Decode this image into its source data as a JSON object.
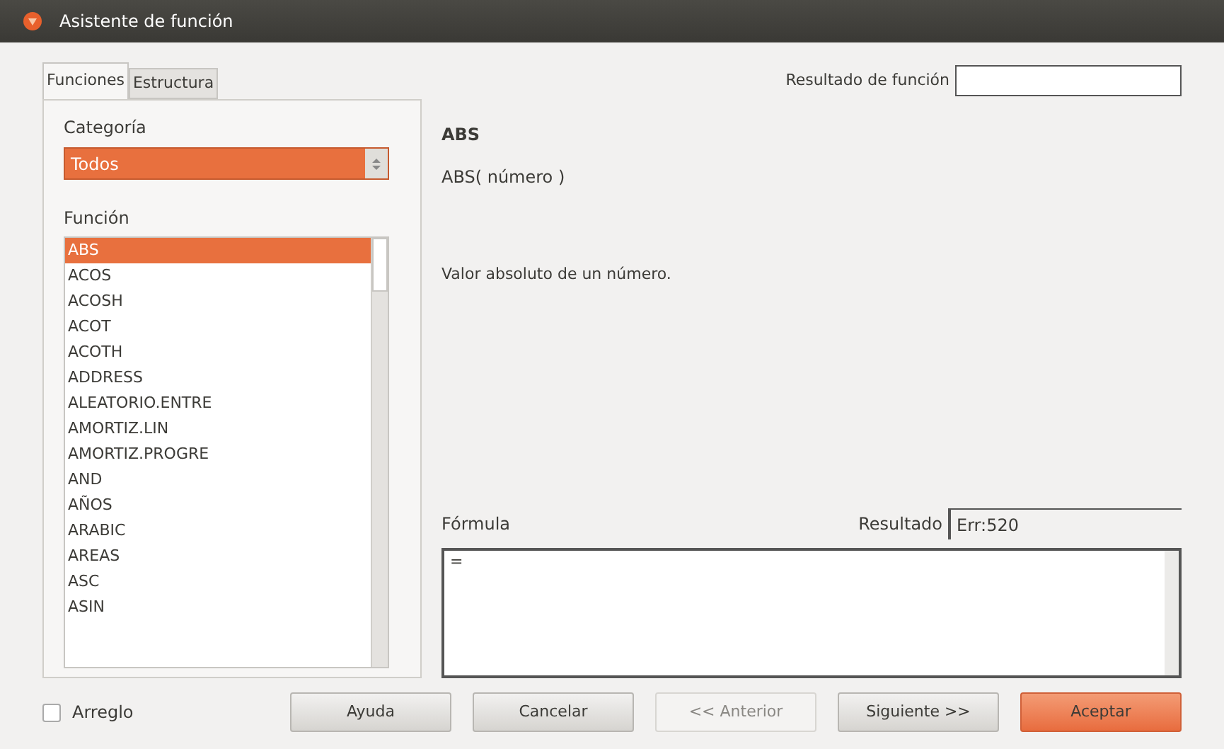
{
  "window": {
    "title": "Asistente de función"
  },
  "tabs": [
    {
      "label": "Funciones",
      "selected": true
    },
    {
      "label": "Estructura",
      "selected": false
    }
  ],
  "category": {
    "label": "Categoría",
    "value": "Todos"
  },
  "function_list": {
    "label": "Función",
    "items": [
      {
        "label": "ABS",
        "selected": true
      },
      {
        "label": "ACOS",
        "selected": false
      },
      {
        "label": "ACOSH",
        "selected": false
      },
      {
        "label": "ACOT",
        "selected": false
      },
      {
        "label": "ACOTH",
        "selected": false
      },
      {
        "label": "ADDRESS",
        "selected": false
      },
      {
        "label": "ALEATORIO.ENTRE",
        "selected": false
      },
      {
        "label": "AMORTIZ.LIN",
        "selected": false
      },
      {
        "label": "AMORTIZ.PROGRE",
        "selected": false
      },
      {
        "label": "AND",
        "selected": false
      },
      {
        "label": "AÑOS",
        "selected": false
      },
      {
        "label": "ARABIC",
        "selected": false
      },
      {
        "label": "AREAS",
        "selected": false
      },
      {
        "label": "ASC",
        "selected": false
      },
      {
        "label": "ASIN",
        "selected": false
      }
    ]
  },
  "function_result": {
    "label": "Resultado de función"
  },
  "function_info": {
    "name": "ABS",
    "syntax": "ABS( número )",
    "description": "Valor absoluto de un número."
  },
  "formula": {
    "label": "Fórmula",
    "value": "="
  },
  "result": {
    "label": "Resultado",
    "value": "Err:520"
  },
  "array_checkbox": {
    "label": "Arreglo",
    "checked": false
  },
  "buttons": [
    {
      "label": "Ayuda",
      "kind": "normal",
      "disabled": false
    },
    {
      "label": "Cancelar",
      "kind": "normal",
      "disabled": false
    },
    {
      "label": "<< Anterior",
      "kind": "normal",
      "disabled": true
    },
    {
      "label": "Siguiente >>",
      "kind": "normal",
      "disabled": false
    },
    {
      "label": "Aceptar",
      "kind": "default",
      "disabled": false
    }
  ]
}
